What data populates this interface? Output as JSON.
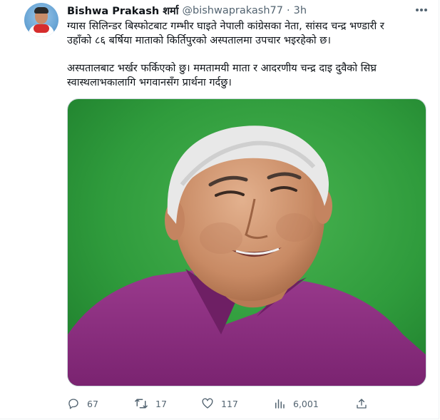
{
  "tweet": {
    "author_name": "Bishwa Prakash शर्मा",
    "handle": "@bishwaprakash77",
    "separator": "·",
    "time": "3h",
    "text_lines": [
      "ग्यास सिलिन्डर बिस्फोटबाट गम्भीर घाइते नेपाली कांग्रेसका नेता, सांसद चन्द्र भण्डारी र",
      "उहाँको ८६ बर्षिया माताको किर्तिपुरको अस्पतालमा उपचार भइरहेको छ।",
      "अस्पतालबाट भर्खर फर्किएको छु। ममतामयी माता र आदरणीय चन्द्र दाइ दुवैको सिघ्र",
      "स्वास्थलाभकालागि भगवानसँग प्रार्थना गर्दछु।"
    ],
    "stats": {
      "replies": "67",
      "retweets": "17",
      "likes": "117",
      "views": "6,001"
    }
  },
  "icons": {
    "more": "more-dots-icon",
    "reply": "reply-icon",
    "retweet": "retweet-icon",
    "like": "heart-icon",
    "views": "views-chart-icon",
    "share": "share-icon"
  },
  "colors": {
    "text": "#0f1419",
    "secondary": "#536471",
    "media_background": "#2f9b3c",
    "shirt": "#8b2b7e"
  }
}
